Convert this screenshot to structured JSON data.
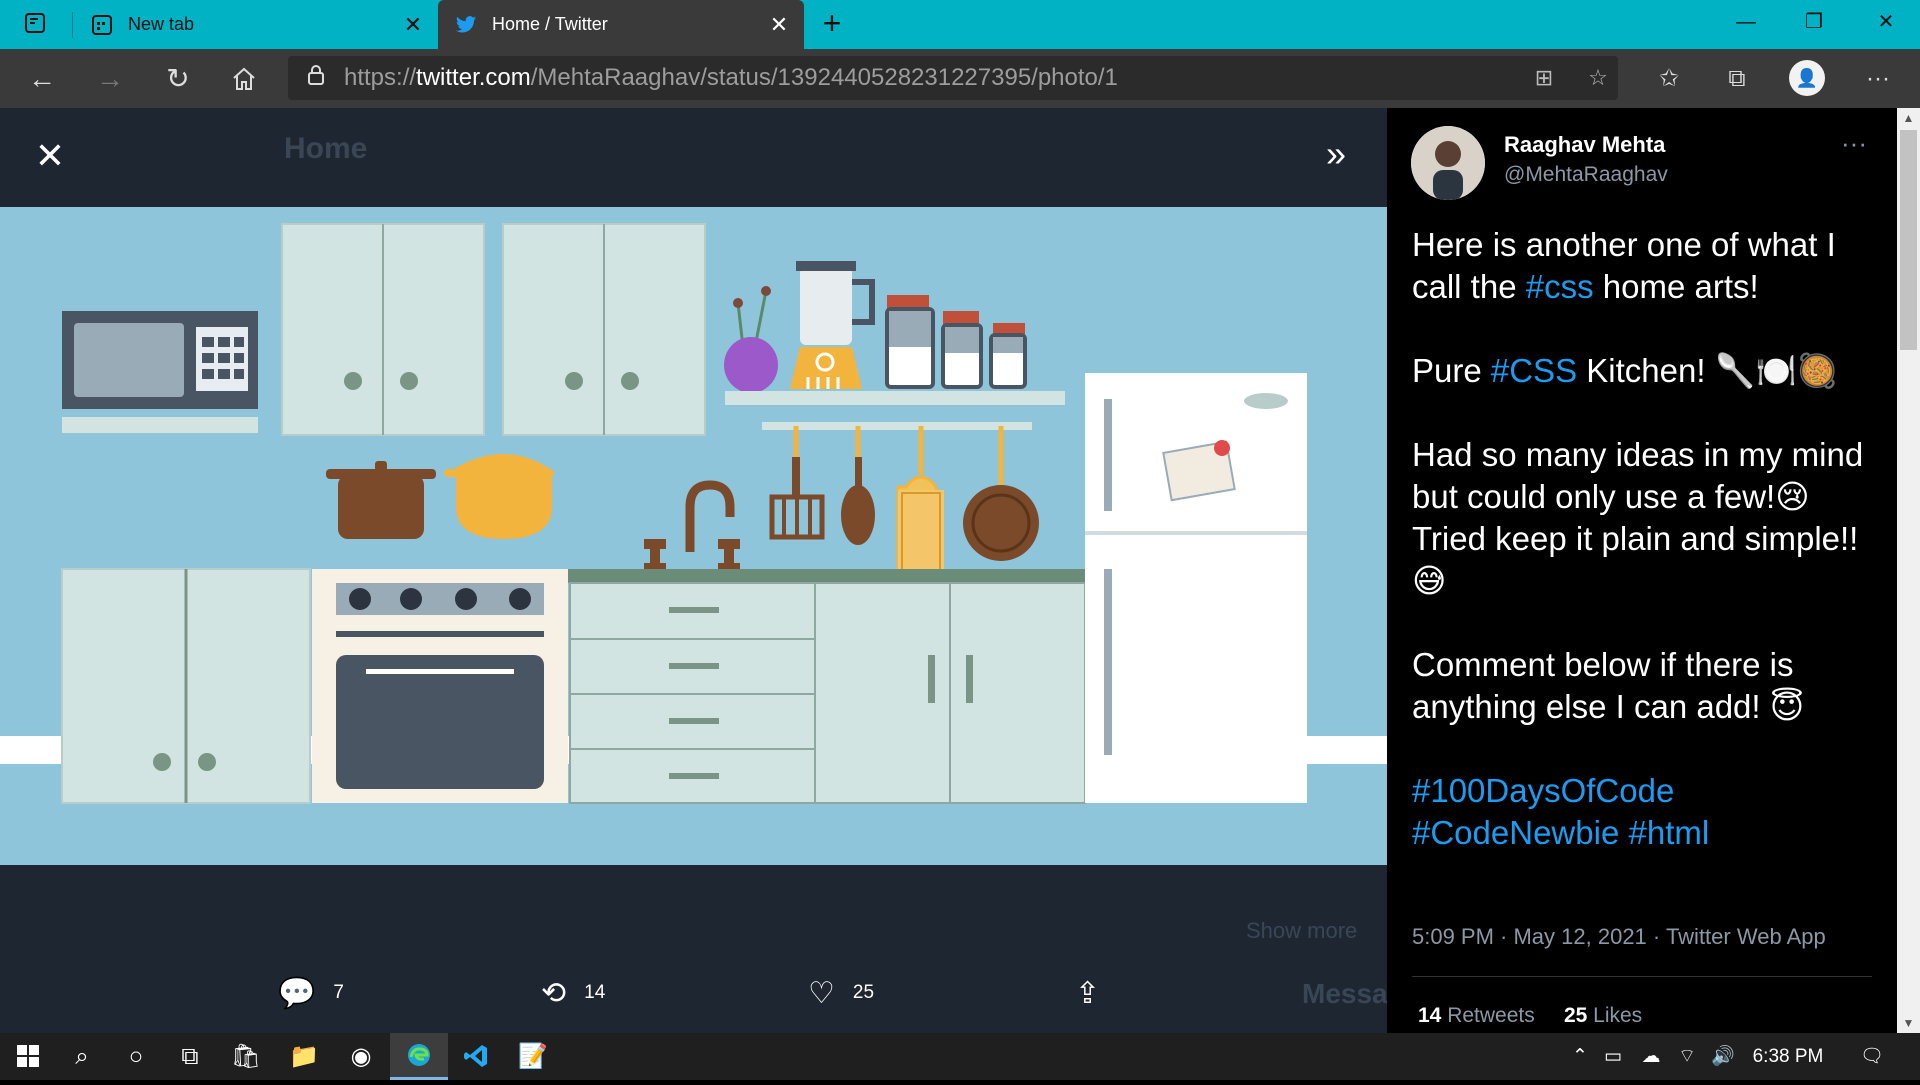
{
  "tabs": [
    {
      "label": "New tab",
      "close": "✕"
    },
    {
      "label": "Home / Twitter",
      "close": "✕"
    }
  ],
  "window_controls": {
    "minimize": "—",
    "restore": "❐",
    "close": "✕"
  },
  "address": {
    "scheme": "https://",
    "host": "twitter.com",
    "path": "/MehtaRaaghav/status/1392440528231227395/photo/1"
  },
  "viewer": {
    "close": "✕",
    "expand": "»",
    "ghost_home": "Home",
    "ghost_show_more": "Show more",
    "ghost_messages": "Messa"
  },
  "actions": {
    "reply_count": "7",
    "retweet_count": "14",
    "like_count": "25"
  },
  "tweet": {
    "name": "Raaghav Mehta",
    "handle": "@MehtaRaaghav",
    "more": "···",
    "p1_a": "Here is another one of what I call the ",
    "p1_tag": "#css",
    "p1_b": " home arts!",
    "p2_a": "Pure ",
    "p2_tag": "#CSS",
    "p2_b": " Kitchen! 🥄🍽️🥘",
    "p3": "Had so many ideas in my mind but could only use a few!😢\nTried keep it plain and simple!!😅",
    "p4": "Comment below if there is anything else I can add! 😇",
    "tags_1": "#100DaysOfCode",
    "tags_2": "#CodeNewbie",
    "tags_3": "#html",
    "meta": "5:09 PM · May 12, 2021 · Twitter Web App",
    "retweets_num": "14",
    "retweets_label": "Retweets",
    "likes_num": "25",
    "likes_label": "Likes"
  },
  "taskbar": {
    "time": "6:38 PM"
  },
  "colors": {
    "tabbar": "#00b2c4",
    "wall": "#8fc5da",
    "cabinet": "#d2e4e1",
    "link": "#1d9bf0"
  }
}
